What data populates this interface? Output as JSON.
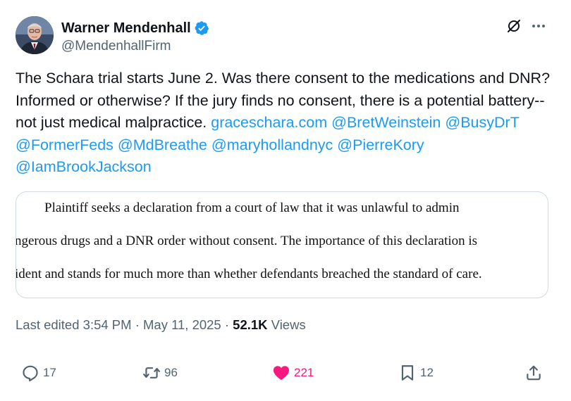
{
  "author": {
    "display_name": "Warner Mendenhall",
    "handle": "@MendenhallFirm",
    "avatar_icon": "avatar-photo",
    "verified_icon": "verified-badge-icon",
    "verified_color": "#1d9bf0"
  },
  "header_actions": {
    "grok_icon": "grok-icon",
    "more_icon": "more-icon"
  },
  "post": {
    "text_parts": [
      {
        "t": "The Schara trial starts June 2.  Was there consent to the medications and DNR?  Informed or otherwise?  If the jury finds no consent, there is a potential battery--not just medical malpractice.  ",
        "link": false
      },
      {
        "t": "graceschara.com",
        "link": true
      },
      {
        "t": " ",
        "link": false
      },
      {
        "t": "@BretWeinstein",
        "link": true
      },
      {
        "t": " ",
        "link": false
      },
      {
        "t": "@BusyDrT",
        "link": true
      },
      {
        "t": " ",
        "link": false
      },
      {
        "t": "@FormerFeds",
        "link": true
      },
      {
        "t": " ",
        "link": false
      },
      {
        "t": "@MdBreathe",
        "link": true
      },
      {
        "t": " ",
        "link": false
      },
      {
        "t": "@maryhollandnyc",
        "link": true
      },
      {
        "t": " ",
        "link": false
      },
      {
        "t": "@PierreKory",
        "link": true
      },
      {
        "t": " ",
        "link": false
      },
      {
        "t": "@IamBrookJackson",
        "link": true
      }
    ],
    "link_color": "#1d9bf0"
  },
  "media": {
    "lines": [
      "Plaintiff seeks a declaration from a court of law that it was unlawful to admin",
      "ngerous drugs and a DNR order without consent. The importance of this declaration is",
      "ident and stands for much more than whether defendants breached the standard of care."
    ]
  },
  "meta": {
    "edited_label": "Last edited 3:54 PM · May 11, 2025 · ",
    "views_count": "52.1K",
    "views_label": " Views"
  },
  "actions": {
    "replies": "17",
    "reposts": "96",
    "likes": "221",
    "bookmarks": "12",
    "like_color": "#f91880",
    "icons": [
      "reply-icon",
      "repost-icon",
      "like-icon",
      "bookmark-icon",
      "share-icon"
    ]
  }
}
